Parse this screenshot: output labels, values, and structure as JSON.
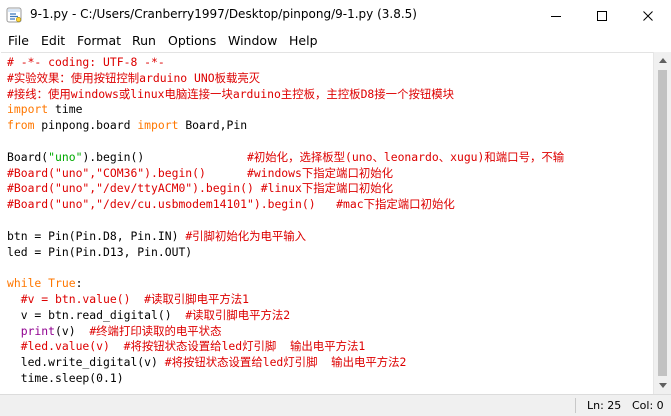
{
  "window": {
    "title": "9-1.py - C:/Users/Cranberry1997/Desktop/pinpong/9-1.py (3.8.5)",
    "app_icon": "python-idle-icon",
    "controls": [
      "minimize-icon",
      "maximize-icon",
      "close-icon"
    ]
  },
  "menu": {
    "items": [
      {
        "label": "File"
      },
      {
        "label": "Edit"
      },
      {
        "label": "Format"
      },
      {
        "label": "Run"
      },
      {
        "label": "Options"
      },
      {
        "label": "Window"
      },
      {
        "label": "Help"
      }
    ]
  },
  "colors": {
    "comment": "#dd0000",
    "keyword": "#ff7700",
    "string": "#00aa00",
    "builtin": "#900090",
    "default": "#000000"
  },
  "editor": {
    "lines": [
      [
        {
          "t": "# -*- coding: UTF-8 -*-",
          "c": "comment"
        }
      ],
      [
        {
          "t": "#实验效果：使用按钮控制arduino UNO板载亮灭",
          "c": "comment"
        }
      ],
      [
        {
          "t": "#接线：使用windows或linux电脑连接一块arduino主控板，主控板D8接一个按钮模块",
          "c": "comment"
        }
      ],
      [
        {
          "t": "import",
          "c": "keyword"
        },
        {
          "t": " time",
          "c": "plain"
        }
      ],
      [
        {
          "t": "from",
          "c": "keyword"
        },
        {
          "t": " pinpong.board ",
          "c": "plain"
        },
        {
          "t": "import",
          "c": "keyword"
        },
        {
          "t": " Board,Pin",
          "c": "plain"
        }
      ],
      [],
      [
        {
          "t": "Board(",
          "c": "plain"
        },
        {
          "t": "\"uno\"",
          "c": "string"
        },
        {
          "t": ").begin()               ",
          "c": "plain"
        },
        {
          "t": "#初始化，选择板型(uno、leonardo、xugu)和端口号，不输",
          "c": "comment"
        }
      ],
      [
        {
          "t": "#Board(\"uno\",\"COM36\").begin()      #windows下指定端口初始化",
          "c": "comment"
        }
      ],
      [
        {
          "t": "#Board(\"uno\",\"/dev/ttyACM0\").begin() #linux下指定端口初始化",
          "c": "comment"
        }
      ],
      [
        {
          "t": "#Board(\"uno\",\"/dev/cu.usbmodem14101\").begin()   #mac下指定端口初始化",
          "c": "comment"
        }
      ],
      [],
      [
        {
          "t": "btn = Pin(Pin.D8, Pin.IN) ",
          "c": "plain"
        },
        {
          "t": "#引脚初始化为电平输入",
          "c": "comment"
        }
      ],
      [
        {
          "t": "led = Pin(Pin.D13, Pin.OUT)",
          "c": "plain"
        }
      ],
      [],
      [
        {
          "t": "while",
          "c": "keyword"
        },
        {
          "t": " ",
          "c": "plain"
        },
        {
          "t": "True",
          "c": "keyword"
        },
        {
          "t": ":",
          "c": "plain"
        }
      ],
      [
        {
          "t": "  #v = btn.value()  #读取引脚电平方法1",
          "c": "comment"
        }
      ],
      [
        {
          "t": "  v = btn.read_digital()  ",
          "c": "plain"
        },
        {
          "t": "#读取引脚电平方法2",
          "c": "comment"
        }
      ],
      [
        {
          "t": "  ",
          "c": "plain"
        },
        {
          "t": "print",
          "c": "builtin"
        },
        {
          "t": "(v)  ",
          "c": "plain"
        },
        {
          "t": "#终端打印读取的电平状态",
          "c": "comment"
        }
      ],
      [
        {
          "t": "  #led.value(v)  #将按钮状态设置给led灯引脚  输出电平方法1",
          "c": "comment"
        }
      ],
      [
        {
          "t": "  led.write_digital(v) ",
          "c": "plain"
        },
        {
          "t": "#将按钮状态设置给led灯引脚  输出电平方法2",
          "c": "comment"
        }
      ],
      [
        {
          "t": "  time.sleep(0.1)",
          "c": "plain"
        }
      ]
    ]
  },
  "status": {
    "line": "Ln: 25",
    "col": "Col: 0"
  }
}
